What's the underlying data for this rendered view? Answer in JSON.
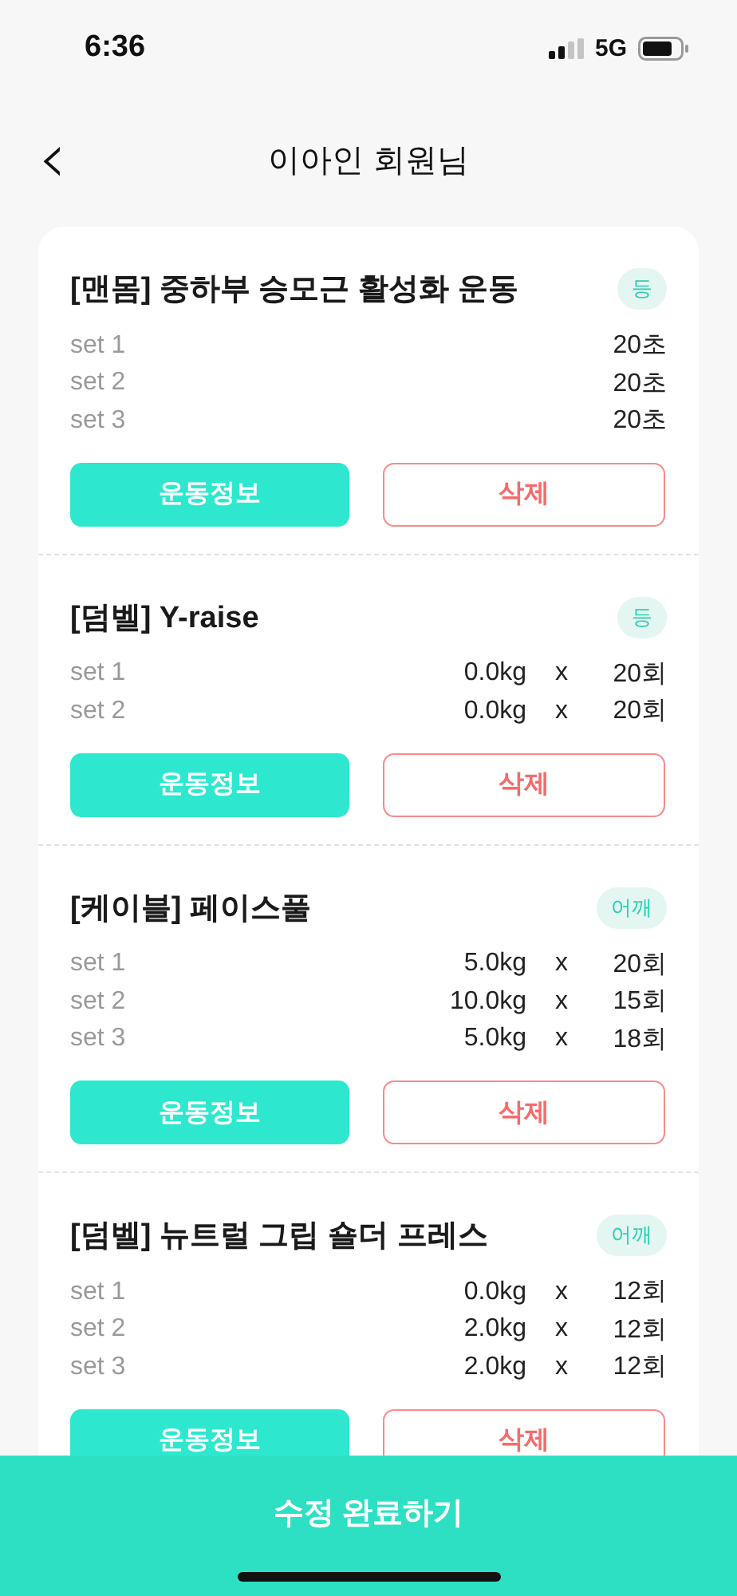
{
  "status_bar": {
    "time": "6:36",
    "network": "5G"
  },
  "header": {
    "back": "‹",
    "title": "이아인 회원님"
  },
  "exercises": [
    {
      "title": "[맨몸] 중하부 승모근 활성화 운동",
      "tag": "등",
      "sets": [
        {
          "kind": "time",
          "label": "set 1",
          "value": "20초"
        },
        {
          "kind": "time",
          "label": "set 2",
          "value": "20초"
        },
        {
          "kind": "time",
          "label": "set 3",
          "value": "20초"
        }
      ],
      "info_button": "운동정보",
      "delete_button": "삭제"
    },
    {
      "title": "[덤벨] Y-raise",
      "tag": "등",
      "sets": [
        {
          "kind": "weight",
          "label": "set 1",
          "weight": "0.0kg",
          "times": "x",
          "reps": "20회"
        },
        {
          "kind": "weight",
          "label": "set 2",
          "weight": "0.0kg",
          "times": "x",
          "reps": "20회"
        }
      ],
      "info_button": "운동정보",
      "delete_button": "삭제"
    },
    {
      "title": "[케이블] 페이스풀",
      "tag": "어깨",
      "sets": [
        {
          "kind": "weight",
          "label": "set 1",
          "weight": "5.0kg",
          "times": "x",
          "reps": "20회"
        },
        {
          "kind": "weight",
          "label": "set 2",
          "weight": "10.0kg",
          "times": "x",
          "reps": "15회"
        },
        {
          "kind": "weight",
          "label": "set 3",
          "weight": "5.0kg",
          "times": "x",
          "reps": "18회"
        }
      ],
      "info_button": "운동정보",
      "delete_button": "삭제"
    },
    {
      "title": "[덤벨] 뉴트럴 그립 숄더 프레스",
      "tag": "어깨",
      "sets": [
        {
          "kind": "weight",
          "label": "set 1",
          "weight": "0.0kg",
          "times": "x",
          "reps": "12회"
        },
        {
          "kind": "weight",
          "label": "set 2",
          "weight": "2.0kg",
          "times": "x",
          "reps": "12회"
        },
        {
          "kind": "weight",
          "label": "set 3",
          "weight": "2.0kg",
          "times": "x",
          "reps": "12회"
        }
      ],
      "info_button": "운동정보",
      "delete_button": "삭제"
    }
  ],
  "bottom_button": "수정 완료하기"
}
